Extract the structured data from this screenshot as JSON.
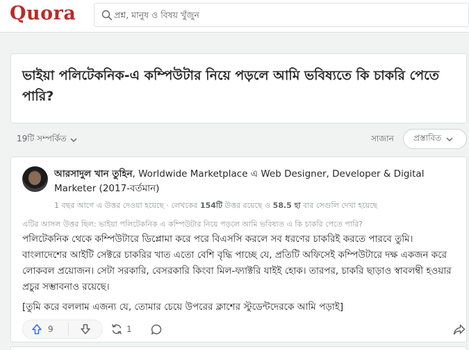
{
  "header": {
    "logo": "Quora",
    "search_placeholder": "প্রশ্ন, মানুষ ও বিষয় খুঁজুন",
    "search_icon": "search-icon"
  },
  "question": {
    "title": "ভাইয়া পলিটেকনিক-এ কম্পিউটার নিয়ে পড়লে আমি ভবিষ্যতে কি চাকরি পেতে পারি?"
  },
  "sortbar": {
    "related": "19টি সম্পর্কিত",
    "sort_label": "সাজান",
    "sort_value": "প্রস্তাবিত"
  },
  "answer": {
    "author_name": "আরসাদুল খান তুহিন",
    "author_credential": ", Worldwide Marketplace এ Web Designer, Developer & Digital Marketer (2017-বর্তমান)",
    "meta_prefix": "1 বছর আগে এ উত্তর দেওয়া হয়েছে · লেখকের ",
    "meta_answers": "154টি",
    "meta_mid": " উত্তর রয়েছে ও ",
    "meta_views": "58.5 হা",
    "meta_suffix": " বার সেগুলি দেখা হয়েছে",
    "original_question": "এটির আসল উত্তর ছিল: ভাইয়া পলিটেকনিক এ কম্পিউটার নিয়ে পড়লে আমি ভবিষ্যত এ কি চাকরি পেতে পারি?",
    "body": "পলিটেকনিক থেকে কম্পিউটারে ডিপ্লোমা করে পরে বিএসসি করলে সব ধরণের চাকরিই করতে পারবে তুমি। বাংলাদেশের আইটি সেক্টরে চাকরির খাত এতো বেশি বৃদ্ধি পাচ্ছে যে, প্রতিটি অফিসেই কম্পিউটারে দক্ষ একজন করে লোকবল প্রয়োজন। সেটা সরকারি, বেসরকারি কিংবা মিল-ফ্যাক্টরি যাইই হোক। তারপর, চাকরি ছাড়াও স্বাবলম্বী হওয়ার প্রচুর সম্ভাবনাও রয়েছে।",
    "body2": "[তুমি করে বললাম এজন্য যে, তোমার চেয়ে উপরের ক্লাশের স্টুডেন্টদেরকে আমি পড়াই]",
    "upvotes": "9",
    "shares": "1"
  },
  "colors": {
    "brand": "#b92b27",
    "upvote": "#2e69ff"
  }
}
